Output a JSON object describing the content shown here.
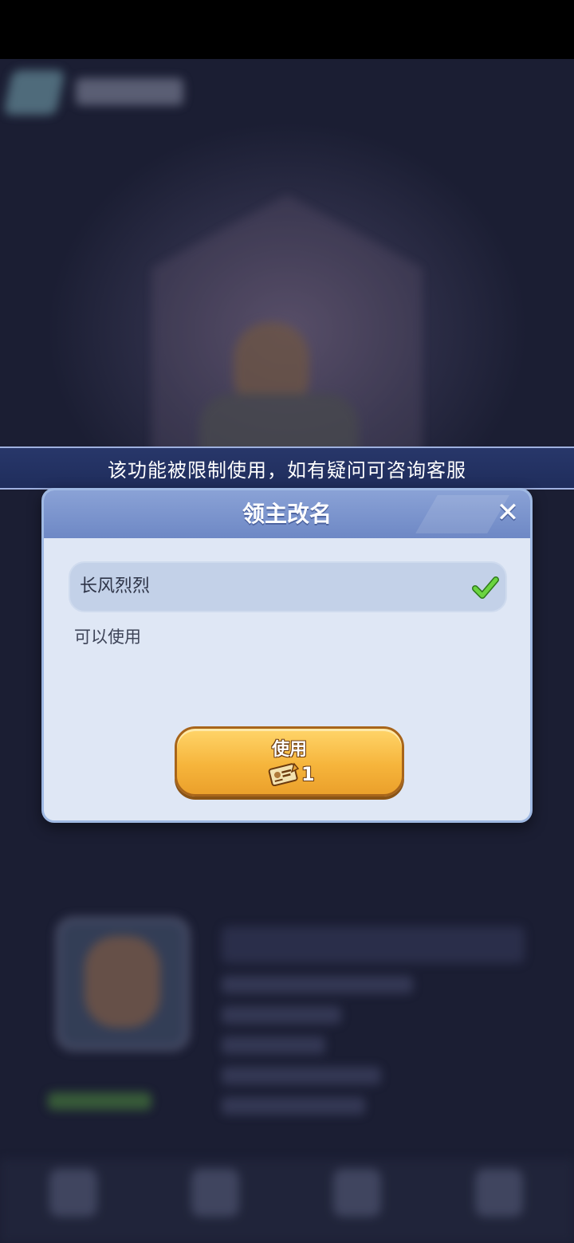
{
  "banner": {
    "text": "该功能被限制使用，如有疑问可咨询客服"
  },
  "dialog": {
    "title": "领主改名",
    "close_icon": "close-icon",
    "name_input": {
      "value": "长风烈烈",
      "valid_icon": "check-icon"
    },
    "status": "可以使用",
    "use_button": {
      "label": "使用",
      "cost_icon": "rename-card-icon",
      "cost_count": "1"
    }
  },
  "colors": {
    "banner": "#1f2d5c",
    "dialog_header": "#7b93cc",
    "dialog_body": "#dfe7f5",
    "button": "#f6b53c",
    "check": "#4bb52c"
  }
}
